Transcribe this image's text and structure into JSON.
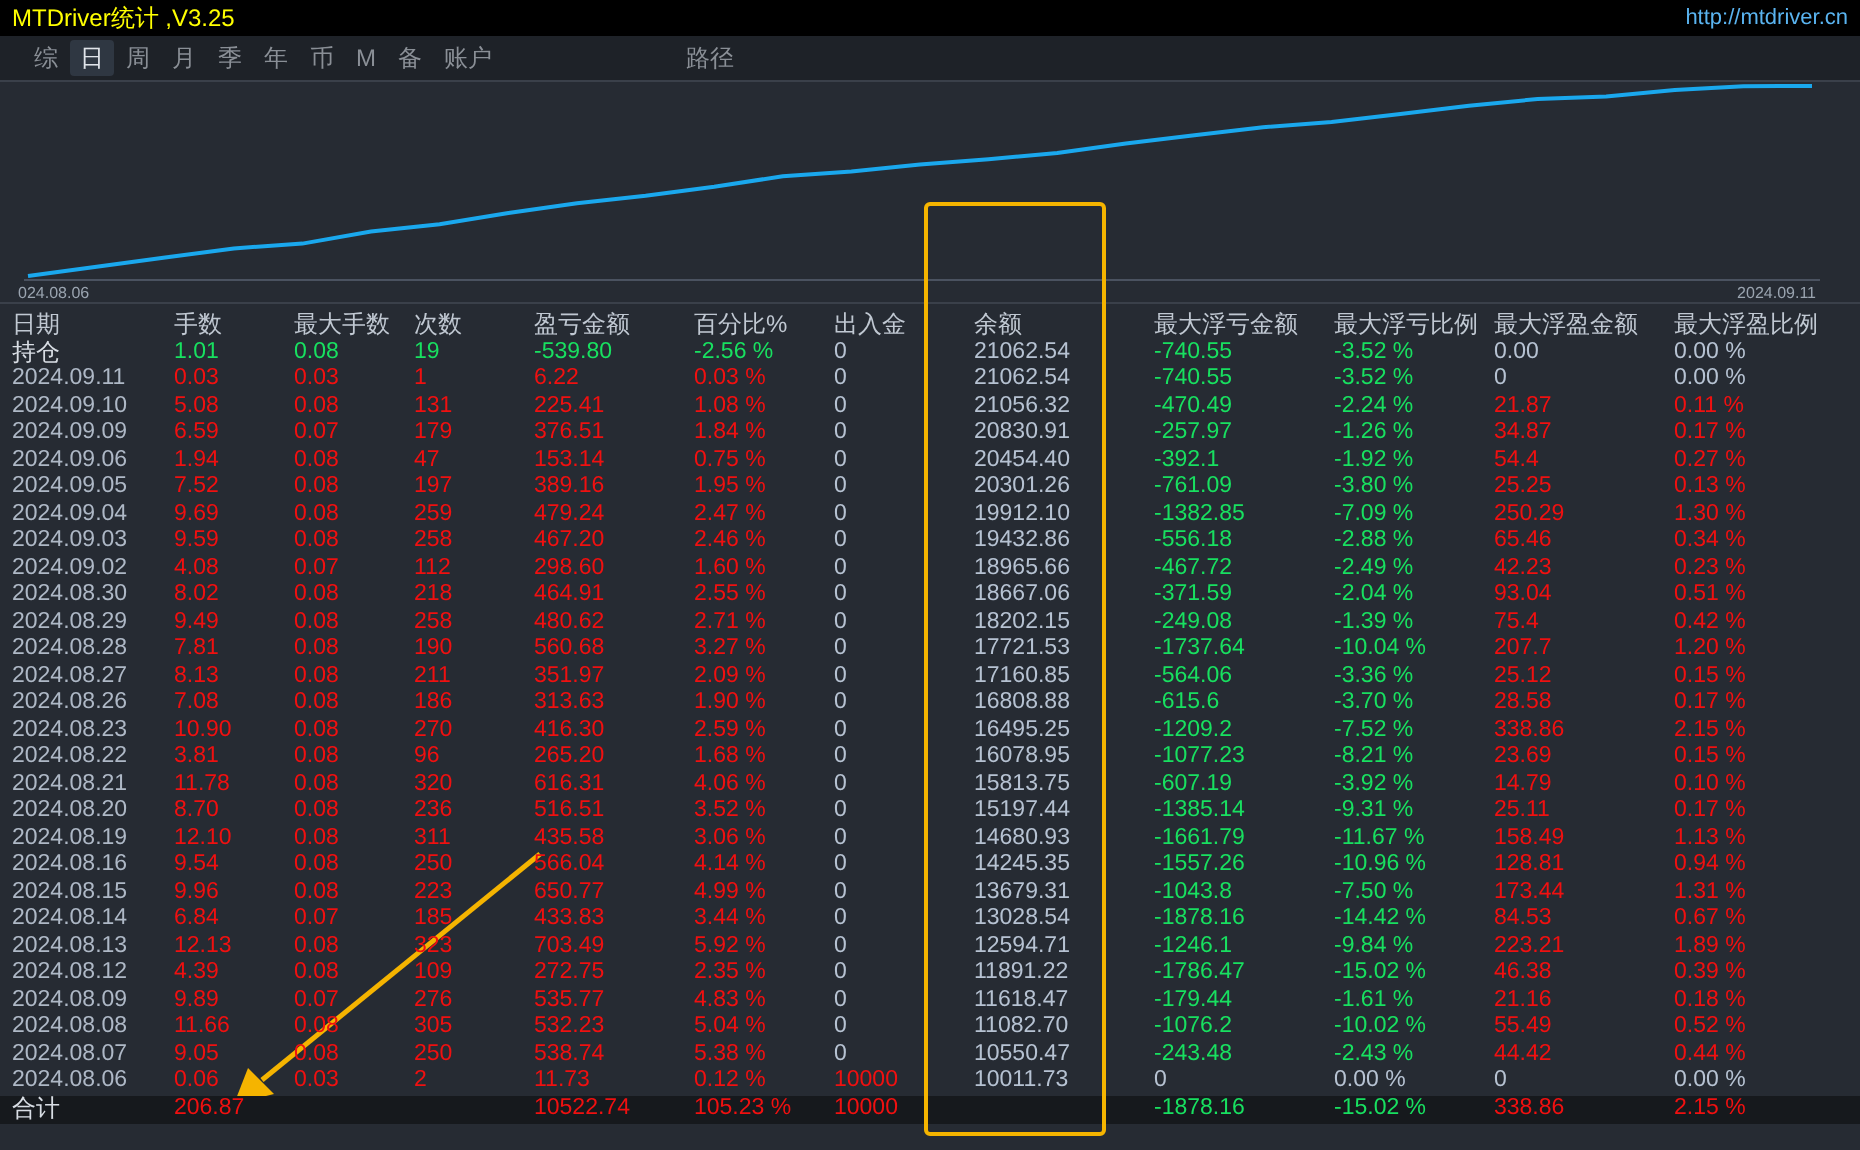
{
  "window": {
    "title": "MTDriver统计 ,V3.25",
    "link": "http://mtdriver.cn"
  },
  "tabs": [
    {
      "label": "综",
      "selected": false
    },
    {
      "label": "日",
      "selected": true
    },
    {
      "label": "周",
      "selected": false
    },
    {
      "label": "月",
      "selected": false
    },
    {
      "label": "季",
      "selected": false
    },
    {
      "label": "年",
      "selected": false
    },
    {
      "label": "币",
      "selected": false
    },
    {
      "label": "M",
      "selected": false
    },
    {
      "label": "备",
      "selected": false
    },
    {
      "label": "账户",
      "selected": false
    }
  ],
  "path_button": "路径",
  "chart": {
    "start_label": "024.08.06",
    "end_label": "2024.09.11"
  },
  "table": {
    "columns": [
      "日期",
      "手数",
      "最大手数",
      "次数",
      "盈亏金额",
      "百分比%",
      "出入金",
      "余额",
      "最大浮亏金额",
      "最大浮亏比例",
      "最大浮盈金额",
      "最大浮盈比例"
    ],
    "rows": [
      {
        "kind": "position",
        "cells": [
          {
            "text": "持仓"
          },
          {
            "text": "1.01",
            "color": "#18e060"
          },
          {
            "text": "0.08",
            "color": "#18e060"
          },
          {
            "text": "19",
            "color": "#18e060"
          },
          {
            "text": "-539.80",
            "color": "#18e060"
          },
          {
            "text": "-2.56 %",
            "color": "#18e060"
          },
          {
            "text": "0",
            "color": "#b6c2d2"
          },
          {
            "text": "21062.54",
            "color": "#b6c2d2"
          },
          {
            "text": "-740.55",
            "color": "#18e060"
          },
          {
            "text": "-3.52 %",
            "color": "#18e060"
          },
          {
            "text": "0.00",
            "color": "#b6c2d2"
          },
          {
            "text": "0.00 %",
            "color": "#b6c2d2"
          }
        ]
      },
      {
        "kind": "day",
        "cells": [
          {
            "text": "2024.09.11"
          },
          {
            "text": "0.03",
            "color": "#f01010"
          },
          {
            "text": "0.03",
            "color": "#f01010"
          },
          {
            "text": "1",
            "color": "#f01010"
          },
          {
            "text": "6.22",
            "color": "#f01010"
          },
          {
            "text": "0.03 %",
            "color": "#f01010"
          },
          {
            "text": "0",
            "color": "#b6c2d2"
          },
          {
            "text": "21062.54",
            "color": "#b6c2d2"
          },
          {
            "text": "-740.55",
            "color": "#18e060"
          },
          {
            "text": "-3.52 %",
            "color": "#18e060"
          },
          {
            "text": "0",
            "color": "#b6c2d2"
          },
          {
            "text": "0.00 %",
            "color": "#b6c2d2"
          }
        ]
      },
      {
        "kind": "day",
        "cells": [
          {
            "text": "2024.09.10"
          },
          {
            "text": "5.08",
            "color": "#f01010"
          },
          {
            "text": "0.08",
            "color": "#f01010"
          },
          {
            "text": "131",
            "color": "#f01010"
          },
          {
            "text": "225.41",
            "color": "#f01010"
          },
          {
            "text": "1.08 %",
            "color": "#f01010"
          },
          {
            "text": "0",
            "color": "#b6c2d2"
          },
          {
            "text": "21056.32",
            "color": "#b6c2d2"
          },
          {
            "text": "-470.49",
            "color": "#18e060"
          },
          {
            "text": "-2.24 %",
            "color": "#18e060"
          },
          {
            "text": "21.87",
            "color": "#f01010"
          },
          {
            "text": "0.11 %",
            "color": "#f01010"
          }
        ]
      },
      {
        "kind": "day",
        "cells": [
          {
            "text": "2024.09.09"
          },
          {
            "text": "6.59",
            "color": "#f01010"
          },
          {
            "text": "0.07",
            "color": "#f01010"
          },
          {
            "text": "179",
            "color": "#f01010"
          },
          {
            "text": "376.51",
            "color": "#f01010"
          },
          {
            "text": "1.84 %",
            "color": "#f01010"
          },
          {
            "text": "0",
            "color": "#b6c2d2"
          },
          {
            "text": "20830.91",
            "color": "#b6c2d2"
          },
          {
            "text": "-257.97",
            "color": "#18e060"
          },
          {
            "text": "-1.26 %",
            "color": "#18e060"
          },
          {
            "text": "34.87",
            "color": "#f01010"
          },
          {
            "text": "0.17 %",
            "color": "#f01010"
          }
        ]
      },
      {
        "kind": "day",
        "cells": [
          {
            "text": "2024.09.06"
          },
          {
            "text": "1.94",
            "color": "#f01010"
          },
          {
            "text": "0.08",
            "color": "#f01010"
          },
          {
            "text": "47",
            "color": "#f01010"
          },
          {
            "text": "153.14",
            "color": "#f01010"
          },
          {
            "text": "0.75 %",
            "color": "#f01010"
          },
          {
            "text": "0",
            "color": "#b6c2d2"
          },
          {
            "text": "20454.40",
            "color": "#b6c2d2"
          },
          {
            "text": "-392.1",
            "color": "#18e060"
          },
          {
            "text": "-1.92 %",
            "color": "#18e060"
          },
          {
            "text": "54.4",
            "color": "#f01010"
          },
          {
            "text": "0.27 %",
            "color": "#f01010"
          }
        ]
      },
      {
        "kind": "day",
        "cells": [
          {
            "text": "2024.09.05"
          },
          {
            "text": "7.52",
            "color": "#f01010"
          },
          {
            "text": "0.08",
            "color": "#f01010"
          },
          {
            "text": "197",
            "color": "#f01010"
          },
          {
            "text": "389.16",
            "color": "#f01010"
          },
          {
            "text": "1.95 %",
            "color": "#f01010"
          },
          {
            "text": "0",
            "color": "#b6c2d2"
          },
          {
            "text": "20301.26",
            "color": "#b6c2d2"
          },
          {
            "text": "-761.09",
            "color": "#18e060"
          },
          {
            "text": "-3.80 %",
            "color": "#18e060"
          },
          {
            "text": "25.25",
            "color": "#f01010"
          },
          {
            "text": "0.13 %",
            "color": "#f01010"
          }
        ]
      },
      {
        "kind": "day",
        "cells": [
          {
            "text": "2024.09.04"
          },
          {
            "text": "9.69",
            "color": "#f01010"
          },
          {
            "text": "0.08",
            "color": "#f01010"
          },
          {
            "text": "259",
            "color": "#f01010"
          },
          {
            "text": "479.24",
            "color": "#f01010"
          },
          {
            "text": "2.47 %",
            "color": "#f01010"
          },
          {
            "text": "0",
            "color": "#b6c2d2"
          },
          {
            "text": "19912.10",
            "color": "#b6c2d2"
          },
          {
            "text": "-1382.85",
            "color": "#18e060"
          },
          {
            "text": "-7.09 %",
            "color": "#18e060"
          },
          {
            "text": "250.29",
            "color": "#f01010"
          },
          {
            "text": "1.30 %",
            "color": "#f01010"
          }
        ]
      },
      {
        "kind": "day",
        "cells": [
          {
            "text": "2024.09.03"
          },
          {
            "text": "9.59",
            "color": "#f01010"
          },
          {
            "text": "0.08",
            "color": "#f01010"
          },
          {
            "text": "258",
            "color": "#f01010"
          },
          {
            "text": "467.20",
            "color": "#f01010"
          },
          {
            "text": "2.46 %",
            "color": "#f01010"
          },
          {
            "text": "0",
            "color": "#b6c2d2"
          },
          {
            "text": "19432.86",
            "color": "#b6c2d2"
          },
          {
            "text": "-556.18",
            "color": "#18e060"
          },
          {
            "text": "-2.88 %",
            "color": "#18e060"
          },
          {
            "text": "65.46",
            "color": "#f01010"
          },
          {
            "text": "0.34 %",
            "color": "#f01010"
          }
        ]
      },
      {
        "kind": "day",
        "cells": [
          {
            "text": "2024.09.02"
          },
          {
            "text": "4.08",
            "color": "#f01010"
          },
          {
            "text": "0.07",
            "color": "#f01010"
          },
          {
            "text": "112",
            "color": "#f01010"
          },
          {
            "text": "298.60",
            "color": "#f01010"
          },
          {
            "text": "1.60 %",
            "color": "#f01010"
          },
          {
            "text": "0",
            "color": "#b6c2d2"
          },
          {
            "text": "18965.66",
            "color": "#b6c2d2"
          },
          {
            "text": "-467.72",
            "color": "#18e060"
          },
          {
            "text": "-2.49 %",
            "color": "#18e060"
          },
          {
            "text": "42.23",
            "color": "#f01010"
          },
          {
            "text": "0.23 %",
            "color": "#f01010"
          }
        ]
      },
      {
        "kind": "day",
        "cells": [
          {
            "text": "2024.08.30"
          },
          {
            "text": "8.02",
            "color": "#f01010"
          },
          {
            "text": "0.08",
            "color": "#f01010"
          },
          {
            "text": "218",
            "color": "#f01010"
          },
          {
            "text": "464.91",
            "color": "#f01010"
          },
          {
            "text": "2.55 %",
            "color": "#f01010"
          },
          {
            "text": "0",
            "color": "#b6c2d2"
          },
          {
            "text": "18667.06",
            "color": "#b6c2d2"
          },
          {
            "text": "-371.59",
            "color": "#18e060"
          },
          {
            "text": "-2.04 %",
            "color": "#18e060"
          },
          {
            "text": "93.04",
            "color": "#f01010"
          },
          {
            "text": "0.51 %",
            "color": "#f01010"
          }
        ]
      },
      {
        "kind": "day",
        "cells": [
          {
            "text": "2024.08.29"
          },
          {
            "text": "9.49",
            "color": "#f01010"
          },
          {
            "text": "0.08",
            "color": "#f01010"
          },
          {
            "text": "258",
            "color": "#f01010"
          },
          {
            "text": "480.62",
            "color": "#f01010"
          },
          {
            "text": "2.71 %",
            "color": "#f01010"
          },
          {
            "text": "0",
            "color": "#b6c2d2"
          },
          {
            "text": "18202.15",
            "color": "#b6c2d2"
          },
          {
            "text": "-249.08",
            "color": "#18e060"
          },
          {
            "text": "-1.39 %",
            "color": "#18e060"
          },
          {
            "text": "75.4",
            "color": "#f01010"
          },
          {
            "text": "0.42 %",
            "color": "#f01010"
          }
        ]
      },
      {
        "kind": "day",
        "cells": [
          {
            "text": "2024.08.28"
          },
          {
            "text": "7.81",
            "color": "#f01010"
          },
          {
            "text": "0.08",
            "color": "#f01010"
          },
          {
            "text": "190",
            "color": "#f01010"
          },
          {
            "text": "560.68",
            "color": "#f01010"
          },
          {
            "text": "3.27 %",
            "color": "#f01010"
          },
          {
            "text": "0",
            "color": "#b6c2d2"
          },
          {
            "text": "17721.53",
            "color": "#b6c2d2"
          },
          {
            "text": "-1737.64",
            "color": "#18e060"
          },
          {
            "text": "-10.04 %",
            "color": "#18e060"
          },
          {
            "text": "207.7",
            "color": "#f01010"
          },
          {
            "text": "1.20 %",
            "color": "#f01010"
          }
        ]
      },
      {
        "kind": "day",
        "cells": [
          {
            "text": "2024.08.27"
          },
          {
            "text": "8.13",
            "color": "#f01010"
          },
          {
            "text": "0.08",
            "color": "#f01010"
          },
          {
            "text": "211",
            "color": "#f01010"
          },
          {
            "text": "351.97",
            "color": "#f01010"
          },
          {
            "text": "2.09 %",
            "color": "#f01010"
          },
          {
            "text": "0",
            "color": "#b6c2d2"
          },
          {
            "text": "17160.85",
            "color": "#b6c2d2"
          },
          {
            "text": "-564.06",
            "color": "#18e060"
          },
          {
            "text": "-3.36 %",
            "color": "#18e060"
          },
          {
            "text": "25.12",
            "color": "#f01010"
          },
          {
            "text": "0.15 %",
            "color": "#f01010"
          }
        ]
      },
      {
        "kind": "day",
        "cells": [
          {
            "text": "2024.08.26"
          },
          {
            "text": "7.08",
            "color": "#f01010"
          },
          {
            "text": "0.08",
            "color": "#f01010"
          },
          {
            "text": "186",
            "color": "#f01010"
          },
          {
            "text": "313.63",
            "color": "#f01010"
          },
          {
            "text": "1.90 %",
            "color": "#f01010"
          },
          {
            "text": "0",
            "color": "#b6c2d2"
          },
          {
            "text": "16808.88",
            "color": "#b6c2d2"
          },
          {
            "text": "-615.6",
            "color": "#18e060"
          },
          {
            "text": "-3.70 %",
            "color": "#18e060"
          },
          {
            "text": "28.58",
            "color": "#f01010"
          },
          {
            "text": "0.17 %",
            "color": "#f01010"
          }
        ]
      },
      {
        "kind": "day",
        "cells": [
          {
            "text": "2024.08.23"
          },
          {
            "text": "10.90",
            "color": "#f01010"
          },
          {
            "text": "0.08",
            "color": "#f01010"
          },
          {
            "text": "270",
            "color": "#f01010"
          },
          {
            "text": "416.30",
            "color": "#f01010"
          },
          {
            "text": "2.59 %",
            "color": "#f01010"
          },
          {
            "text": "0",
            "color": "#b6c2d2"
          },
          {
            "text": "16495.25",
            "color": "#b6c2d2"
          },
          {
            "text": "-1209.2",
            "color": "#18e060"
          },
          {
            "text": "-7.52 %",
            "color": "#18e060"
          },
          {
            "text": "338.86",
            "color": "#f01010"
          },
          {
            "text": "2.15 %",
            "color": "#f01010"
          }
        ]
      },
      {
        "kind": "day",
        "cells": [
          {
            "text": "2024.08.22"
          },
          {
            "text": "3.81",
            "color": "#f01010"
          },
          {
            "text": "0.08",
            "color": "#f01010"
          },
          {
            "text": "96",
            "color": "#f01010"
          },
          {
            "text": "265.20",
            "color": "#f01010"
          },
          {
            "text": "1.68 %",
            "color": "#f01010"
          },
          {
            "text": "0",
            "color": "#b6c2d2"
          },
          {
            "text": "16078.95",
            "color": "#b6c2d2"
          },
          {
            "text": "-1077.23",
            "color": "#18e060"
          },
          {
            "text": "-8.21 %",
            "color": "#18e060"
          },
          {
            "text": "23.69",
            "color": "#f01010"
          },
          {
            "text": "0.15 %",
            "color": "#f01010"
          }
        ]
      },
      {
        "kind": "day",
        "cells": [
          {
            "text": "2024.08.21"
          },
          {
            "text": "11.78",
            "color": "#f01010"
          },
          {
            "text": "0.08",
            "color": "#f01010"
          },
          {
            "text": "320",
            "color": "#f01010"
          },
          {
            "text": "616.31",
            "color": "#f01010"
          },
          {
            "text": "4.06 %",
            "color": "#f01010"
          },
          {
            "text": "0",
            "color": "#b6c2d2"
          },
          {
            "text": "15813.75",
            "color": "#b6c2d2"
          },
          {
            "text": "-607.19",
            "color": "#18e060"
          },
          {
            "text": "-3.92 %",
            "color": "#18e060"
          },
          {
            "text": "14.79",
            "color": "#f01010"
          },
          {
            "text": "0.10 %",
            "color": "#f01010"
          }
        ]
      },
      {
        "kind": "day",
        "cells": [
          {
            "text": "2024.08.20"
          },
          {
            "text": "8.70",
            "color": "#f01010"
          },
          {
            "text": "0.08",
            "color": "#f01010"
          },
          {
            "text": "236",
            "color": "#f01010"
          },
          {
            "text": "516.51",
            "color": "#f01010"
          },
          {
            "text": "3.52 %",
            "color": "#f01010"
          },
          {
            "text": "0",
            "color": "#b6c2d2"
          },
          {
            "text": "15197.44",
            "color": "#b6c2d2"
          },
          {
            "text": "-1385.14",
            "color": "#18e060"
          },
          {
            "text": "-9.31 %",
            "color": "#18e060"
          },
          {
            "text": "25.11",
            "color": "#f01010"
          },
          {
            "text": "0.17 %",
            "color": "#f01010"
          }
        ]
      },
      {
        "kind": "day",
        "cells": [
          {
            "text": "2024.08.19"
          },
          {
            "text": "12.10",
            "color": "#f01010"
          },
          {
            "text": "0.08",
            "color": "#f01010"
          },
          {
            "text": "311",
            "color": "#f01010"
          },
          {
            "text": "435.58",
            "color": "#f01010"
          },
          {
            "text": "3.06 %",
            "color": "#f01010"
          },
          {
            "text": "0",
            "color": "#b6c2d2"
          },
          {
            "text": "14680.93",
            "color": "#b6c2d2"
          },
          {
            "text": "-1661.79",
            "color": "#18e060"
          },
          {
            "text": "-11.67 %",
            "color": "#18e060"
          },
          {
            "text": "158.49",
            "color": "#f01010"
          },
          {
            "text": "1.13 %",
            "color": "#f01010"
          }
        ]
      },
      {
        "kind": "day",
        "cells": [
          {
            "text": "2024.08.16"
          },
          {
            "text": "9.54",
            "color": "#f01010"
          },
          {
            "text": "0.08",
            "color": "#f01010"
          },
          {
            "text": "250",
            "color": "#f01010"
          },
          {
            "text": "566.04",
            "color": "#f01010"
          },
          {
            "text": "4.14 %",
            "color": "#f01010"
          },
          {
            "text": "0",
            "color": "#b6c2d2"
          },
          {
            "text": "14245.35",
            "color": "#b6c2d2"
          },
          {
            "text": "-1557.26",
            "color": "#18e060"
          },
          {
            "text": "-10.96 %",
            "color": "#18e060"
          },
          {
            "text": "128.81",
            "color": "#f01010"
          },
          {
            "text": "0.94 %",
            "color": "#f01010"
          }
        ]
      },
      {
        "kind": "day",
        "cells": [
          {
            "text": "2024.08.15"
          },
          {
            "text": "9.96",
            "color": "#f01010"
          },
          {
            "text": "0.08",
            "color": "#f01010"
          },
          {
            "text": "223",
            "color": "#f01010"
          },
          {
            "text": "650.77",
            "color": "#f01010"
          },
          {
            "text": "4.99 %",
            "color": "#f01010"
          },
          {
            "text": "0",
            "color": "#b6c2d2"
          },
          {
            "text": "13679.31",
            "color": "#b6c2d2"
          },
          {
            "text": "-1043.8",
            "color": "#18e060"
          },
          {
            "text": "-7.50 %",
            "color": "#18e060"
          },
          {
            "text": "173.44",
            "color": "#f01010"
          },
          {
            "text": "1.31 %",
            "color": "#f01010"
          }
        ]
      },
      {
        "kind": "day",
        "cells": [
          {
            "text": "2024.08.14"
          },
          {
            "text": "6.84",
            "color": "#f01010"
          },
          {
            "text": "0.07",
            "color": "#f01010"
          },
          {
            "text": "185",
            "color": "#f01010"
          },
          {
            "text": "433.83",
            "color": "#f01010"
          },
          {
            "text": "3.44 %",
            "color": "#f01010"
          },
          {
            "text": "0",
            "color": "#b6c2d2"
          },
          {
            "text": "13028.54",
            "color": "#b6c2d2"
          },
          {
            "text": "-1878.16",
            "color": "#18e060"
          },
          {
            "text": "-14.42 %",
            "color": "#18e060"
          },
          {
            "text": "84.53",
            "color": "#f01010"
          },
          {
            "text": "0.67 %",
            "color": "#f01010"
          }
        ]
      },
      {
        "kind": "day",
        "cells": [
          {
            "text": "2024.08.13"
          },
          {
            "text": "12.13",
            "color": "#f01010"
          },
          {
            "text": "0.08",
            "color": "#f01010"
          },
          {
            "text": "323",
            "color": "#f01010"
          },
          {
            "text": "703.49",
            "color": "#f01010"
          },
          {
            "text": "5.92 %",
            "color": "#f01010"
          },
          {
            "text": "0",
            "color": "#b6c2d2"
          },
          {
            "text": "12594.71",
            "color": "#b6c2d2"
          },
          {
            "text": "-1246.1",
            "color": "#18e060"
          },
          {
            "text": "-9.84 %",
            "color": "#18e060"
          },
          {
            "text": "223.21",
            "color": "#f01010"
          },
          {
            "text": "1.89 %",
            "color": "#f01010"
          }
        ]
      },
      {
        "kind": "day",
        "cells": [
          {
            "text": "2024.08.12"
          },
          {
            "text": "4.39",
            "color": "#f01010"
          },
          {
            "text": "0.08",
            "color": "#f01010"
          },
          {
            "text": "109",
            "color": "#f01010"
          },
          {
            "text": "272.75",
            "color": "#f01010"
          },
          {
            "text": "2.35 %",
            "color": "#f01010"
          },
          {
            "text": "0",
            "color": "#b6c2d2"
          },
          {
            "text": "11891.22",
            "color": "#b6c2d2"
          },
          {
            "text": "-1786.47",
            "color": "#18e060"
          },
          {
            "text": "-15.02 %",
            "color": "#18e060"
          },
          {
            "text": "46.38",
            "color": "#f01010"
          },
          {
            "text": "0.39 %",
            "color": "#f01010"
          }
        ]
      },
      {
        "kind": "day",
        "cells": [
          {
            "text": "2024.08.09"
          },
          {
            "text": "9.89",
            "color": "#f01010"
          },
          {
            "text": "0.07",
            "color": "#f01010"
          },
          {
            "text": "276",
            "color": "#f01010"
          },
          {
            "text": "535.77",
            "color": "#f01010"
          },
          {
            "text": "4.83 %",
            "color": "#f01010"
          },
          {
            "text": "0",
            "color": "#b6c2d2"
          },
          {
            "text": "11618.47",
            "color": "#b6c2d2"
          },
          {
            "text": "-179.44",
            "color": "#18e060"
          },
          {
            "text": "-1.61 %",
            "color": "#18e060"
          },
          {
            "text": "21.16",
            "color": "#f01010"
          },
          {
            "text": "0.18 %",
            "color": "#f01010"
          }
        ]
      },
      {
        "kind": "day",
        "cells": [
          {
            "text": "2024.08.08"
          },
          {
            "text": "11.66",
            "color": "#f01010"
          },
          {
            "text": "0.08",
            "color": "#f01010"
          },
          {
            "text": "305",
            "color": "#f01010"
          },
          {
            "text": "532.23",
            "color": "#f01010"
          },
          {
            "text": "5.04 %",
            "color": "#f01010"
          },
          {
            "text": "0",
            "color": "#b6c2d2"
          },
          {
            "text": "11082.70",
            "color": "#b6c2d2"
          },
          {
            "text": "-1076.2",
            "color": "#18e060"
          },
          {
            "text": "-10.02 %",
            "color": "#18e060"
          },
          {
            "text": "55.49",
            "color": "#f01010"
          },
          {
            "text": "0.52 %",
            "color": "#f01010"
          }
        ]
      },
      {
        "kind": "day",
        "cells": [
          {
            "text": "2024.08.07"
          },
          {
            "text": "9.05",
            "color": "#f01010"
          },
          {
            "text": "0.08",
            "color": "#f01010"
          },
          {
            "text": "250",
            "color": "#f01010"
          },
          {
            "text": "538.74",
            "color": "#f01010"
          },
          {
            "text": "5.38 %",
            "color": "#f01010"
          },
          {
            "text": "0",
            "color": "#b6c2d2"
          },
          {
            "text": "10550.47",
            "color": "#b6c2d2"
          },
          {
            "text": "-243.48",
            "color": "#18e060"
          },
          {
            "text": "-2.43 %",
            "color": "#18e060"
          },
          {
            "text": "44.42",
            "color": "#f01010"
          },
          {
            "text": "0.44 %",
            "color": "#f01010"
          }
        ]
      },
      {
        "kind": "day",
        "cells": [
          {
            "text": "2024.08.06"
          },
          {
            "text": "0.06",
            "color": "#f01010"
          },
          {
            "text": "0.03",
            "color": "#f01010"
          },
          {
            "text": "2",
            "color": "#f01010"
          },
          {
            "text": "11.73",
            "color": "#f01010"
          },
          {
            "text": "0.12 %",
            "color": "#f01010"
          },
          {
            "text": "10000",
            "color": "#f01010"
          },
          {
            "text": "10011.73",
            "color": "#b6c2d2"
          },
          {
            "text": "0",
            "color": "#b6c2d2"
          },
          {
            "text": "0.00 %",
            "color": "#b6c2d2"
          },
          {
            "text": "0",
            "color": "#b6c2d2"
          },
          {
            "text": "0.00 %",
            "color": "#b6c2d2"
          }
        ]
      },
      {
        "kind": "total",
        "cells": [
          {
            "text": "合计"
          },
          {
            "text": "206.87",
            "color": "#f01010"
          },
          "",
          "",
          {
            "text": "10522.74",
            "color": "#f01010"
          },
          {
            "text": "105.23 %",
            "color": "#f01010"
          },
          {
            "text": "10000",
            "color": "#f01010"
          },
          "",
          {
            "text": "-1878.16",
            "color": "#18e060"
          },
          {
            "text": "-15.02 %",
            "color": "#18e060"
          },
          {
            "text": "338.86",
            "color": "#f01010"
          },
          {
            "text": "2.15 %",
            "color": "#f01010"
          }
        ]
      }
    ]
  }
}
